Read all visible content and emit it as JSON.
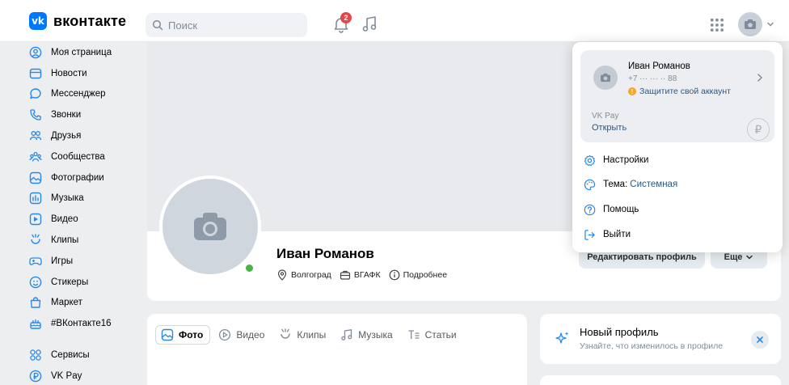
{
  "header": {
    "logo_text": "вконтакте",
    "logo_mark": "vk",
    "search_placeholder": "Поиск",
    "notifications_count": "2"
  },
  "sidebar": {
    "items": [
      {
        "label": "Моя страница",
        "icon": "user-circle-icon"
      },
      {
        "label": "Новости",
        "icon": "news-icon"
      },
      {
        "label": "Мессенджер",
        "icon": "message-icon"
      },
      {
        "label": "Звонки",
        "icon": "phone-icon"
      },
      {
        "label": "Друзья",
        "icon": "friends-icon"
      },
      {
        "label": "Сообщества",
        "icon": "communities-icon"
      },
      {
        "label": "Фотографии",
        "icon": "photo-icon"
      },
      {
        "label": "Музыка",
        "icon": "music-icon"
      },
      {
        "label": "Видео",
        "icon": "video-icon"
      },
      {
        "label": "Клипы",
        "icon": "clips-icon"
      },
      {
        "label": "Игры",
        "icon": "games-icon"
      },
      {
        "label": "Стикеры",
        "icon": "sticker-icon"
      },
      {
        "label": "Маркет",
        "icon": "market-icon"
      },
      {
        "label": "#ВКонтакте16",
        "icon": "cake-icon"
      },
      {
        "label": "Сервисы",
        "icon": "services-icon"
      },
      {
        "label": "VK Pay",
        "icon": "vkpay-icon"
      }
    ]
  },
  "profile": {
    "name": "Иван Романов",
    "city": "Волгоград",
    "education": "ВГАФК",
    "details": "Подробнее",
    "edit_label": "Редактировать профиль",
    "more_label": "Еще"
  },
  "tabs": [
    {
      "label": "Фото",
      "active": true
    },
    {
      "label": "Видео",
      "active": false
    },
    {
      "label": "Клипы",
      "active": false
    },
    {
      "label": "Музыка",
      "active": false
    },
    {
      "label": "Статьи",
      "active": false
    }
  ],
  "new_profile": {
    "title": "Новый профиль",
    "subtitle": "Узнайте, что изменилось в профиле"
  },
  "account_menu": {
    "name": "Иван Романов",
    "phone": "+7 ··· ··· ·· 88",
    "warning": "Защитите свой аккаунт",
    "pay_label": "VK Pay",
    "pay_open": "Открыть",
    "items": {
      "settings": "Настройки",
      "theme_label": "Тема:",
      "theme_value": "Системная",
      "help": "Помощь",
      "logout": "Выйти"
    }
  },
  "colors": {
    "brand": "#0077ff",
    "link": "#2a5885",
    "badge": "#e64646",
    "online": "#4bb34b"
  }
}
